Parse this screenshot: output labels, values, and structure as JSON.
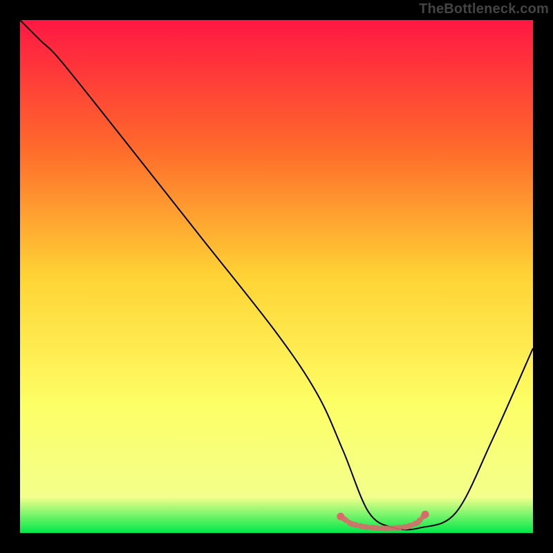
{
  "watermark": "TheBottleneck.com",
  "chart_data": {
    "type": "line",
    "title": "",
    "xlabel": "",
    "ylabel": "",
    "xlim": [
      0,
      100
    ],
    "ylim": [
      0,
      100
    ],
    "gradient_stops": [
      {
        "offset": 0,
        "color": "#ff1744"
      },
      {
        "offset": 25,
        "color": "#ff6a2b"
      },
      {
        "offset": 50,
        "color": "#ffd335"
      },
      {
        "offset": 75,
        "color": "#fdff66"
      },
      {
        "offset": 93,
        "color": "#f3ff8c"
      },
      {
        "offset": 100,
        "color": "#00e84a"
      }
    ],
    "series": [
      {
        "name": "bottleneck-curve",
        "color": "#000000",
        "x": [
          0,
          4,
          8,
          20,
          35,
          50,
          58,
          63,
          68,
          73,
          78,
          85,
          92,
          100
        ],
        "y": [
          100,
          96,
          92,
          77,
          58,
          39,
          27,
          16,
          4,
          1,
          1,
          4,
          18,
          36
        ]
      }
    ],
    "markers": {
      "name": "highlight-band",
      "color": "#d86a6a",
      "x": [
        62.5,
        64.5,
        67.0,
        70.0,
        73.0,
        75.5,
        77.5,
        79.0
      ],
      "y": [
        3.2,
        1.8,
        1.2,
        0.9,
        0.9,
        1.2,
        2.0,
        3.6
      ]
    }
  }
}
